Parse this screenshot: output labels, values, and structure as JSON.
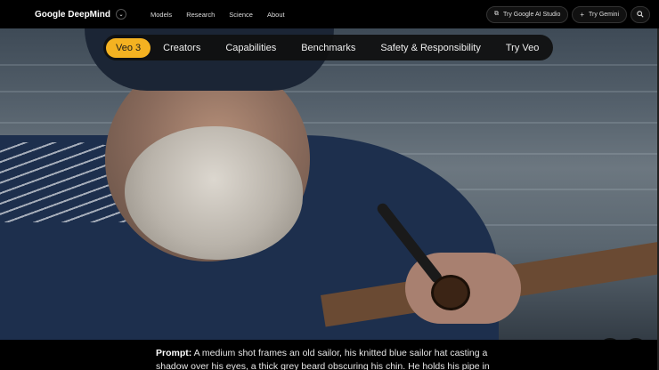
{
  "nav": {
    "logo": "Google DeepMind",
    "links": [
      "Models",
      "Research",
      "Science",
      "About"
    ],
    "ai_studio": "Try Google AI Studio",
    "gemini": "Try Gemini"
  },
  "tabs": [
    "Veo 3",
    "Creators",
    "Capabilities",
    "Benchmarks",
    "Safety & Responsibility",
    "Try Veo"
  ],
  "active_tab": "Veo 3",
  "caption": {
    "label": "Prompt:",
    "text": "A medium shot frames an old sailor, his knitted blue sailor hat casting a shadow over his eyes, a thick grey beard obscuring his chin. He holds his pipe in one"
  },
  "icons": {
    "mute": "mute-icon",
    "pause": "pause-icon",
    "search": "search-icon"
  }
}
